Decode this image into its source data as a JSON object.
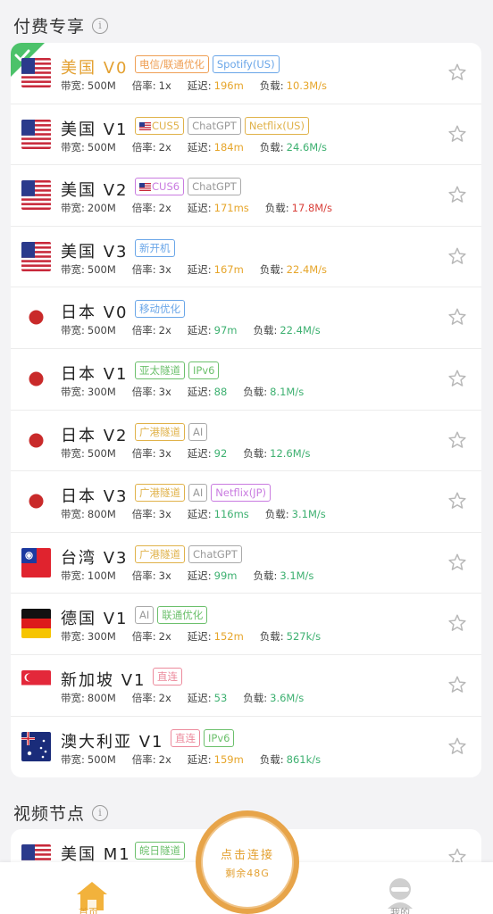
{
  "sections": {
    "paid": {
      "title": "付费专享",
      "info": "i"
    },
    "video": {
      "title": "视频节点",
      "info": "i"
    }
  },
  "labels": {
    "bandwidth": "带宽:",
    "rate": "倍率:",
    "latency": "延迟:",
    "load": "负载:"
  },
  "colors": {
    "accent": "#e3a030",
    "green": "#3db070",
    "red": "#d9403a",
    "star": "#b8b8b8"
  },
  "nodes": [
    {
      "flag": "us",
      "name": "美国 V0",
      "selected": true,
      "tags": [
        {
          "text": "电信/联通优化",
          "color": "orange"
        },
        {
          "text": "Spotify(US)",
          "color": "blue"
        }
      ],
      "bandwidth": "500M",
      "rate": "1x",
      "latency": "196m",
      "latency_color": "yellow",
      "load": "10.3M/s",
      "load_color": "yellow"
    },
    {
      "flag": "us",
      "name": "美国 V1",
      "tags": [
        {
          "text": "CUS5",
          "color": "yellow",
          "flag": true
        },
        {
          "text": "ChatGPT",
          "color": "gray"
        },
        {
          "text": "Netflix(US)",
          "color": "yellow"
        }
      ],
      "bandwidth": "500M",
      "rate": "2x",
      "latency": "184m",
      "latency_color": "yellow",
      "load": "24.6M/s",
      "load_color": "green"
    },
    {
      "flag": "us",
      "name": "美国 V2",
      "tags": [
        {
          "text": "CUS6",
          "color": "purple",
          "flag": true
        },
        {
          "text": "ChatGPT",
          "color": "gray"
        }
      ],
      "bandwidth": "200M",
      "rate": "2x",
      "latency": "171ms",
      "latency_color": "yellow",
      "load": "17.8M/s",
      "load_color": "red"
    },
    {
      "flag": "us",
      "name": "美国 V3",
      "tags": [
        {
          "text": "新开机",
          "color": "blue"
        }
      ],
      "bandwidth": "500M",
      "rate": "3x",
      "latency": "167m",
      "latency_color": "yellow",
      "load": "22.4M/s",
      "load_color": "yellow"
    },
    {
      "flag": "jp",
      "name": "日本 V0",
      "tags": [
        {
          "text": "移动优化",
          "color": "blue"
        }
      ],
      "bandwidth": "500M",
      "rate": "2x",
      "latency": "97m",
      "latency_color": "green",
      "load": "22.4M/s",
      "load_color": "green"
    },
    {
      "flag": "jp",
      "name": "日本 V1",
      "tags": [
        {
          "text": "亚太隧道",
          "color": "green"
        },
        {
          "text": "IPv6",
          "color": "green"
        }
      ],
      "bandwidth": "300M",
      "rate": "3x",
      "latency": "88",
      "latency_color": "green",
      "load": "8.1M/s",
      "load_color": "green"
    },
    {
      "flag": "jp",
      "name": "日本 V2",
      "tags": [
        {
          "text": "广港隧道",
          "color": "yellow"
        },
        {
          "text": "AI",
          "color": "gray"
        }
      ],
      "bandwidth": "500M",
      "rate": "3x",
      "latency": "92",
      "latency_color": "green",
      "load": "12.6M/s",
      "load_color": "green"
    },
    {
      "flag": "jp",
      "name": "日本 V3",
      "tags": [
        {
          "text": "广港隧道",
          "color": "yellow"
        },
        {
          "text": "AI",
          "color": "gray"
        },
        {
          "text": "Netflix(JP)",
          "color": "purple"
        }
      ],
      "bandwidth": "800M",
      "rate": "3x",
      "latency": "116ms",
      "latency_color": "green",
      "load": "3.1M/s",
      "load_color": "green"
    },
    {
      "flag": "tw",
      "name": "台湾 V3",
      "tags": [
        {
          "text": "广港隧道",
          "color": "yellow"
        },
        {
          "text": "ChatGPT",
          "color": "gray"
        }
      ],
      "bandwidth": "100M",
      "rate": "3x",
      "latency": "99m",
      "latency_color": "green",
      "load": "3.1M/s",
      "load_color": "green"
    },
    {
      "flag": "de",
      "name": "德国 V1",
      "tags": [
        {
          "text": "AI",
          "color": "gray"
        },
        {
          "text": "联通优化",
          "color": "green"
        }
      ],
      "bandwidth": "300M",
      "rate": "2x",
      "latency": "152m",
      "latency_color": "yellow",
      "load": "527k/s",
      "load_color": "green"
    },
    {
      "flag": "sg",
      "name": "新加坡 V1",
      "tags": [
        {
          "text": "直连",
          "color": "pink"
        }
      ],
      "bandwidth": "800M",
      "rate": "2x",
      "latency": "53",
      "latency_color": "green",
      "load": "3.6M/s",
      "load_color": "green"
    },
    {
      "flag": "au",
      "name": "澳大利亚 V1",
      "tags": [
        {
          "text": "直连",
          "color": "pink"
        },
        {
          "text": "IPv6",
          "color": "green"
        }
      ],
      "bandwidth": "500M",
      "rate": "2x",
      "latency": "159m",
      "latency_color": "yellow",
      "load": "861k/s",
      "load_color": "green"
    }
  ],
  "video_nodes": [
    {
      "flag": "us",
      "name": "美国 M1",
      "tags": [
        {
          "text": "皖日隧道",
          "color": "green"
        }
      ]
    }
  ],
  "connect": {
    "label": "点击连接",
    "remaining": "剩余48G"
  },
  "nav": {
    "home_label": "首页",
    "me_label": "我的"
  }
}
